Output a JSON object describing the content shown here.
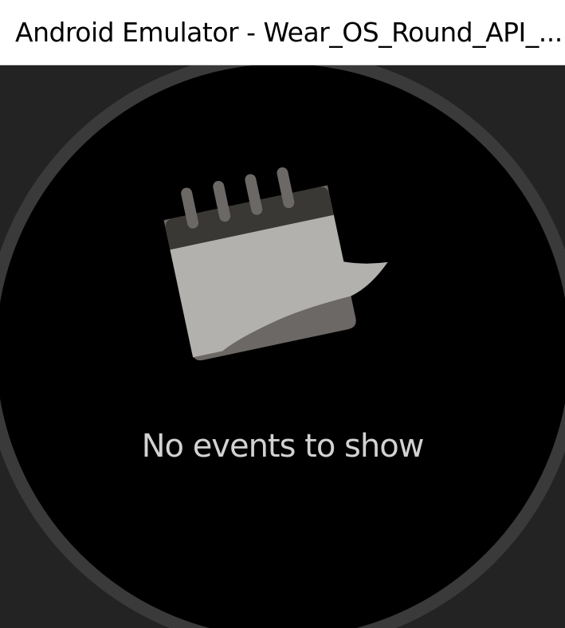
{
  "window": {
    "title": "Android Emulator - Wear_OS_Round_API_..."
  },
  "watch": {
    "icon": "calendar-icon",
    "empty_message": "No events to show"
  },
  "colors": {
    "bezel": "#3a3a3a",
    "screen": "#000000",
    "background": "#232323",
    "text": "#d2d2d2",
    "paper": "#b3b1ad",
    "paper_back": "#6b6865",
    "calendar_header": "#3a3835"
  }
}
